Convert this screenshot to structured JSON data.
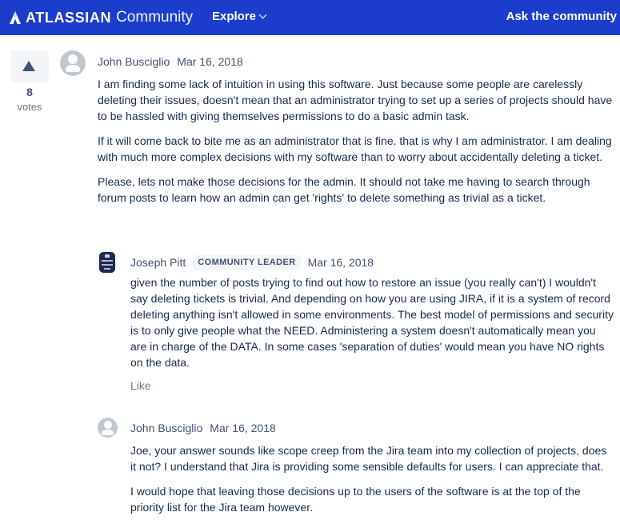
{
  "header": {
    "brand": "ATLASSIAN",
    "product": "Community",
    "explore_label": "Explore",
    "ask_label": "Ask the community",
    "background_color": "#1c3dcc"
  },
  "vote": {
    "count": "8",
    "label": "votes"
  },
  "main_post": {
    "author": "John Busciglio",
    "date": "Mar 16, 2018",
    "paragraphs": [
      "I am finding some lack of intuition in using this software.  Just because some people are carelessly deleting their issues, doesn't mean that an administrator trying to set up a series of projects should have to be hassled with giving themselves permissions to do a basic admin task.",
      "If it will come back to bite me as an administrator that is fine.  that is why I am administrator.  I am dealing with much more complex decisions with my software than to worry about accidentally deleting a ticket.",
      "Please, lets not make those decisions for the admin.  It should not take me having to search through forum posts to learn how an admin can get 'rights' to delete something as trivial as a ticket."
    ]
  },
  "reply_1": {
    "author": "Joseph Pitt",
    "badge": "COMMUNITY LEADER",
    "date": "Mar 16, 2018",
    "paragraphs": [
      "given the number of posts trying to find out how to restore an issue (you really can't) I wouldn't say deleting tickets is trivial. And depending on how you are using JIRA, if it is a system of record deleting anything isn't allowed in some environments.  The best model of permissions and security is to only give people what the NEED. Administering a system doesn't automatically mean you are in charge of the DATA. In some cases 'separation of duties' would mean you have NO rights on the data."
    ],
    "like_label": "Like"
  },
  "reply_2": {
    "author": "John Busciglio",
    "date": "Mar 16, 2018",
    "paragraphs": [
      "Joe, your answer sounds like scope creep from the Jira team into my collection of projects, does it not?  I understand that Jira is providing some sensible defaults for users.  I can appreciate that.",
      "I would hope that leaving those decisions up to the users of the software is at the top of the priority list for the Jira team however."
    ]
  }
}
